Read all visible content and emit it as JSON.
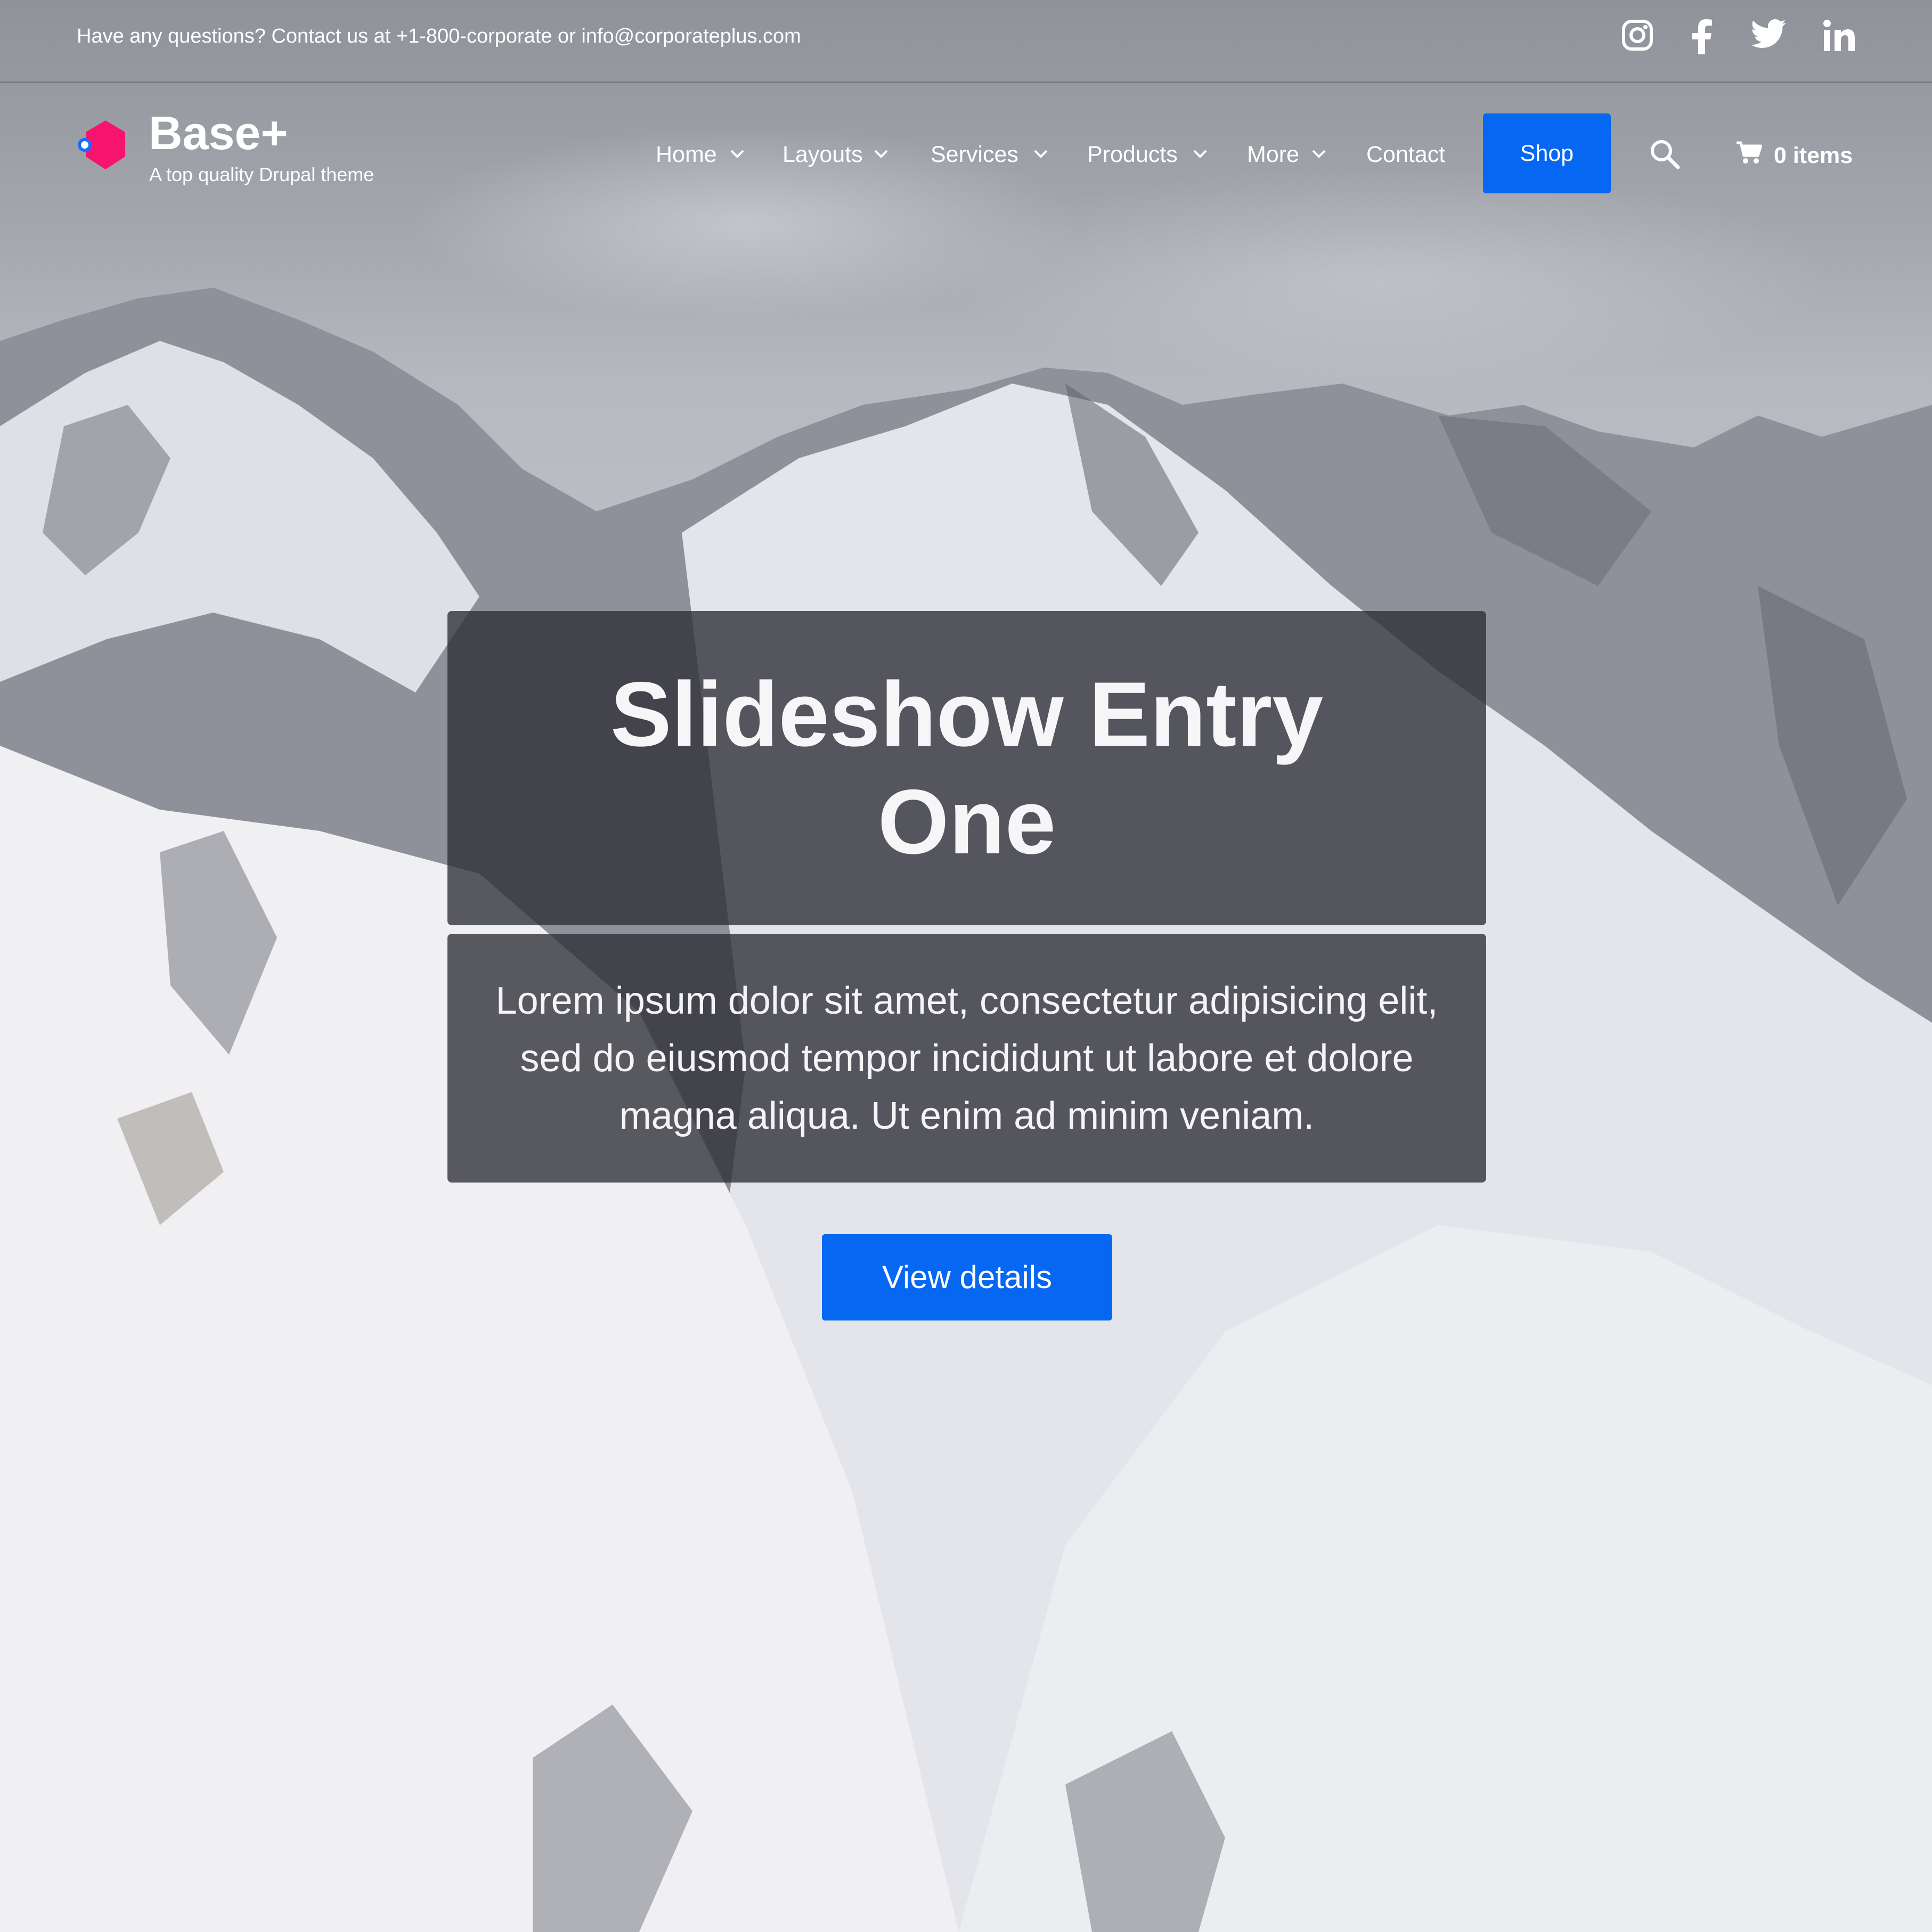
{
  "top_bar": {
    "contact_text": "Have any questions? Contact us at +1-800-corporate or info@corporateplus.com",
    "social_icons": [
      "instagram-icon",
      "facebook-icon",
      "twitter-icon",
      "linkedin-icon"
    ]
  },
  "branding": {
    "site_name": "Base+",
    "slogan": "A top quality Drupal theme",
    "logo_colors": [
      "#f7146e",
      "#1a6cf5"
    ]
  },
  "nav": {
    "items": [
      {
        "label": "Home",
        "has_dropdown": true
      },
      {
        "label": "Layouts",
        "has_dropdown": true
      },
      {
        "label": "Services",
        "has_dropdown": true
      },
      {
        "label": "Products",
        "has_dropdown": true
      },
      {
        "label": "More",
        "has_dropdown": true
      },
      {
        "label": "Contact",
        "has_dropdown": false
      }
    ],
    "shop_label": "Shop",
    "cart_label": "0 items"
  },
  "slide": {
    "title": "Slideshow Entry One",
    "text": "Lorem ipsum dolor sit amet, consectetur adipisicing elit, sed do eiusmod tempor incididunt ut labore et dolore magna aliqua. Ut enim ad minim veniam.",
    "button_label": "View details"
  },
  "colors": {
    "accent": "#0567f2",
    "overlay": "#2d2d34"
  }
}
